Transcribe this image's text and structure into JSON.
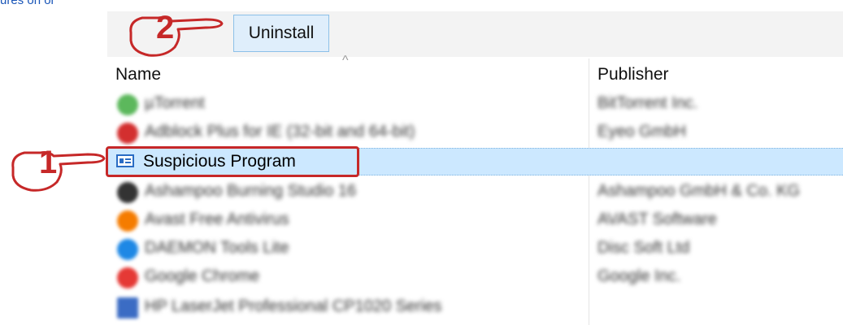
{
  "top_link": "ures on or",
  "toolbar": {
    "uninstall_label": "Uninstall"
  },
  "columns": {
    "name": "Name",
    "publisher": "Publisher"
  },
  "rows": [
    {
      "name": "µTorrent",
      "publisher": "BitTorrent Inc.",
      "icon": "utorrent-icon",
      "icon_color": "#5cb85c"
    },
    {
      "name": "Adblock Plus for IE (32-bit and 64-bit)",
      "publisher": "Eyeo GmbH",
      "icon": "adblock-icon",
      "icon_color": "#d32f2f"
    },
    {
      "name": "Suspicious Program",
      "publisher": "",
      "icon": "program-icon",
      "icon_color": "#2a6cc4"
    },
    {
      "name": "Ashampoo Burning Studio 16",
      "publisher": "Ashampoo GmbH & Co. KG",
      "icon": "ashampoo-icon",
      "icon_color": "#333333"
    },
    {
      "name": "Avast Free Antivirus",
      "publisher": "AVAST Software",
      "icon": "avast-icon",
      "icon_color": "#f57c00"
    },
    {
      "name": "DAEMON Tools Lite",
      "publisher": "Disc Soft Ltd",
      "icon": "daemon-tools-icon",
      "icon_color": "#1e88e5"
    },
    {
      "name": "Google Chrome",
      "publisher": "Google Inc.",
      "icon": "chrome-icon",
      "icon_color": "#e53935"
    },
    {
      "name": "HP LaserJet Professional CP1020 Series",
      "publisher": "",
      "icon": "printer-icon",
      "icon_color": "#3b6cc4"
    }
  ],
  "annotations": [
    {
      "number": "1",
      "target": "Suspicious Program",
      "color": "#c62828"
    },
    {
      "number": "2",
      "target": "Uninstall",
      "color": "#c62828"
    }
  ],
  "colors": {
    "selection": "#cce8ff",
    "button": "#dfeefb",
    "highlight_box": "#c62828"
  }
}
